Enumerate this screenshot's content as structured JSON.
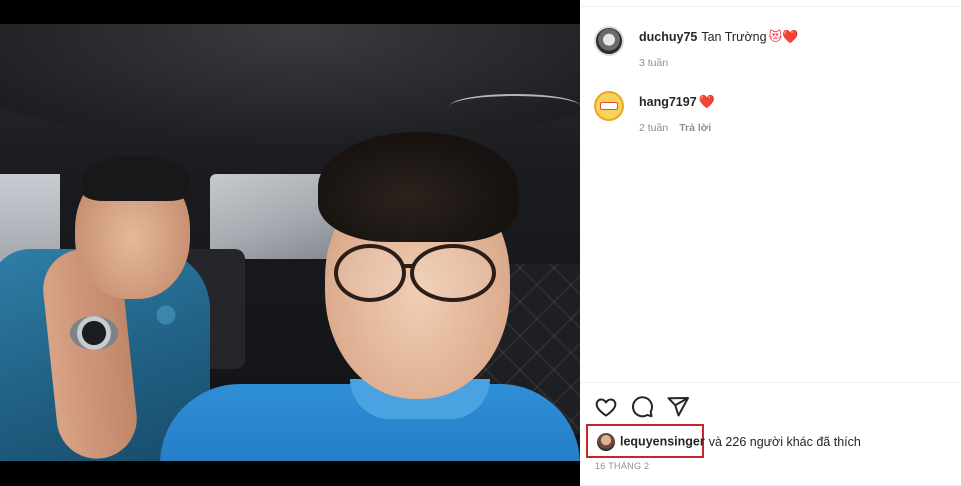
{
  "post": {
    "media_alt": ""
  },
  "comments": [
    {
      "username": "duchuy75",
      "text": "Tan Trường",
      "emoji": "😻❤️",
      "time": "3 tuần",
      "reply": ""
    },
    {
      "username": "hang7197",
      "text": "",
      "emoji": "❤️",
      "time": "2 tuần",
      "reply": "Trả lời"
    }
  ],
  "actions": {
    "like": "heart-icon",
    "comment": "comment-icon",
    "share": "share-icon"
  },
  "likes": {
    "username": "lequyensinger",
    "rest": "và 226 người khác đã thích"
  },
  "date": "16 THÁNG 2",
  "colors": {
    "highlight_box": "#c8242c",
    "heart": "#ed4956",
    "meta": "#8e8e8e"
  }
}
